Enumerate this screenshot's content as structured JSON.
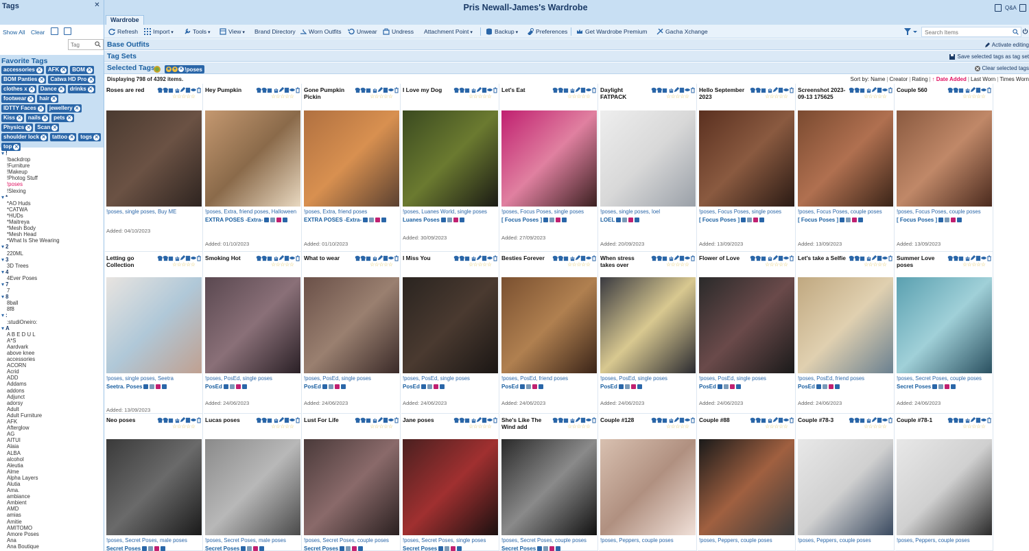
{
  "app": {
    "title": "Pris Newall-James's Wardrobe",
    "qa": "Q&A"
  },
  "tabs": [
    {
      "label": "Wardrobe"
    }
  ],
  "toolbar": {
    "refresh": "Refresh",
    "import": "Import",
    "tools": "Tools",
    "view": "View",
    "brand_directory": "Brand Directory",
    "worn_outfits": "Worn Outfits",
    "unwear": "Unwear",
    "undress": "Undress",
    "attachment_point": "Attachment Point",
    "backup": "Backup",
    "preferences": "Preferences",
    "premium": "Get Wardrobe Premium",
    "gacha": "Gacha Xchange",
    "search_placeholder": "Search Items"
  },
  "sidebar": {
    "title": "Tags",
    "show_all": "Show All",
    "clear": "Clear",
    "tag_placeholder": "Tag",
    "favorite_title": "Favorite Tags",
    "favorites": [
      "accessories",
      "AFK",
      "BOM",
      "BOM Panties",
      "Catwa HD Pro",
      "clothes x",
      "Dance",
      "drinks",
      "footwear",
      "hair",
      "IDTTY Faces",
      "jewellery",
      "Kiss",
      "nails",
      "pets",
      "Physics",
      "Scan",
      "shoulder lock",
      "tattoo",
      "togs",
      "top"
    ],
    "tree": [
      {
        "t": "g",
        "v": "!"
      },
      {
        "t": "i",
        "v": "!backdrop"
      },
      {
        "t": "i",
        "v": "!Furniture"
      },
      {
        "t": "i",
        "v": "!Makeup"
      },
      {
        "t": "i",
        "v": "!Photog Stuff"
      },
      {
        "t": "a",
        "v": "!poses"
      },
      {
        "t": "i",
        "v": "!Slexing"
      },
      {
        "t": "g",
        "v": "*"
      },
      {
        "t": "i",
        "v": "*AO Huds"
      },
      {
        "t": "i",
        "v": "*CATWA"
      },
      {
        "t": "i",
        "v": "*HUDs"
      },
      {
        "t": "i",
        "v": "*Maitreya"
      },
      {
        "t": "i",
        "v": "*Mesh Body"
      },
      {
        "t": "i",
        "v": "*Mesh Head"
      },
      {
        "t": "i",
        "v": "*What Is She Wearing"
      },
      {
        "t": "g",
        "v": "2"
      },
      {
        "t": "i",
        "v": "220ML"
      },
      {
        "t": "g",
        "v": "3"
      },
      {
        "t": "i",
        "v": "3D Trees"
      },
      {
        "t": "g",
        "v": "4"
      },
      {
        "t": "i",
        "v": "4Ever Poses"
      },
      {
        "t": "g",
        "v": "7"
      },
      {
        "t": "i",
        "v": "7"
      },
      {
        "t": "g",
        "v": "8"
      },
      {
        "t": "i",
        "v": "8ball"
      },
      {
        "t": "i",
        "v": "8f8"
      },
      {
        "t": "g",
        "v": ":"
      },
      {
        "t": "i",
        "v": ":studiOneiro:"
      },
      {
        "t": "g",
        "v": "A"
      },
      {
        "t": "i",
        "v": "A B E D U L"
      },
      {
        "t": "i",
        "v": "A*S"
      },
      {
        "t": "i",
        "v": "Aardvark"
      },
      {
        "t": "i",
        "v": "above knee"
      },
      {
        "t": "i",
        "v": "accessories"
      },
      {
        "t": "i",
        "v": "ACORN"
      },
      {
        "t": "i",
        "v": "Acrid"
      },
      {
        "t": "i",
        "v": "ADD"
      },
      {
        "t": "i",
        "v": "Addams"
      },
      {
        "t": "i",
        "v": "addons"
      },
      {
        "t": "i",
        "v": "Adjunct"
      },
      {
        "t": "i",
        "v": "adorsy"
      },
      {
        "t": "i",
        "v": "Adult"
      },
      {
        "t": "i",
        "v": "Adult Furniture"
      },
      {
        "t": "i",
        "v": "AFK"
      },
      {
        "t": "i",
        "v": "Afterglow"
      },
      {
        "t": "i",
        "v": "AG"
      },
      {
        "t": "i",
        "v": "AITUI"
      },
      {
        "t": "i",
        "v": "Alaia"
      },
      {
        "t": "i",
        "v": "ALBA"
      },
      {
        "t": "i",
        "v": "alcohol"
      },
      {
        "t": "i",
        "v": "Aleutia"
      },
      {
        "t": "i",
        "v": "Alme"
      },
      {
        "t": "i",
        "v": "Alpha Layers"
      },
      {
        "t": "i",
        "v": "Alutia"
      },
      {
        "t": "i",
        "v": "Ama."
      },
      {
        "t": "i",
        "v": "ambiance"
      },
      {
        "t": "i",
        "v": "Ambient"
      },
      {
        "t": "i",
        "v": "AMD"
      },
      {
        "t": "i",
        "v": "amias"
      },
      {
        "t": "i",
        "v": "Amitie"
      },
      {
        "t": "i",
        "v": "AMITOMO"
      },
      {
        "t": "i",
        "v": "Amore Poses"
      },
      {
        "t": "i",
        "v": "Ana"
      },
      {
        "t": "i",
        "v": "Ana Boutique"
      }
    ]
  },
  "sections": {
    "base_outfits": "Base Outfits",
    "activate_editing": "Activate editing",
    "tag_sets": "Tag Sets",
    "save_tags": "Save selected tags as tag set",
    "selected_tags": "Selected Tags",
    "selected_chip": "!poses",
    "clear_selected": "Clear selected tags"
  },
  "listing": {
    "display_count": "Displaying 798 of 4392 items.",
    "sort_label": "Sort by:",
    "sort_options": [
      "Name",
      "Creator",
      "Rating",
      "Date Added",
      "Last Worn",
      "Times Worn"
    ],
    "sort_active": "Date Added"
  },
  "items": [
    {
      "title": "Roses are red",
      "tags": "!poses, single poses, Buy ME",
      "creator": "",
      "added": "Added: 04/10/2023",
      "img": [
        "#4a3a30",
        "#6b5244",
        "#2e2420"
      ]
    },
    {
      "title": "Hey Pumpkin",
      "tags": "!poses, Extra, friend poses, Halloween",
      "creator": "EXTRA POSES -Extra-",
      "added": "Added: 01/10/2023",
      "img": [
        "#c49870",
        "#8a6a4a",
        "#e8d8c0"
      ]
    },
    {
      "title": "Gone Pumpkin Pickin",
      "tags": "!poses, Extra, friend poses",
      "creator": "EXTRA POSES -Extra-",
      "added": "Added: 01/10/2023",
      "img": [
        "#b07040",
        "#d89050",
        "#5a4030"
      ]
    },
    {
      "title": "I Love my Dog",
      "tags": "!poses, Luanes World, single poses",
      "creator": "Luanes Poses",
      "added": "Added: 30/09/2023",
      "img": [
        "#3a4a20",
        "#6b7a30",
        "#1a1a14"
      ]
    },
    {
      "title": "Let's Eat",
      "tags": "!poses, Focus Poses, single poses",
      "creator": "[ Focus Poses ]",
      "added": "Added: 27/09/2023",
      "img": [
        "#c02070",
        "#e080a0",
        "#3a2020"
      ]
    },
    {
      "title": "Daylight FATPACK",
      "tags": "!poses, single poses, loel",
      "creator": "LOEL",
      "added": "Added: 20/09/2023",
      "img": [
        "#eeeeee",
        "#d8d8d8",
        "#9aa0a8"
      ]
    },
    {
      "title": "Hello September 2023",
      "tags": "!poses, Focus Poses, single poses",
      "creator": "[ Focus Poses ]",
      "added": "Added: 13/09/2023",
      "img": [
        "#5a3020",
        "#8a5a40",
        "#2a1a14"
      ]
    },
    {
      "title": "Screenshot 2023-09-13 175625",
      "tags": "!poses, Focus Poses, couple poses",
      "creator": "[ Focus Poses ]",
      "added": "Added: 13/09/2023",
      "img": [
        "#7a4a30",
        "#b07050",
        "#3a2418"
      ]
    },
    {
      "title": "Couple 560",
      "tags": "!poses, Focus Poses, couple poses",
      "creator": "[ Focus Poses ]",
      "added": "Added: 13/09/2023",
      "img": [
        "#8a5a40",
        "#c08868",
        "#4a2a1e"
      ]
    },
    {
      "title": "Letting go Collection",
      "tags": "!poses, single poses, Seetra",
      "creator": "Seetra. Poses",
      "added": "Added: 13/09/2023",
      "img": [
        "#e8e4e0",
        "#b0c8d8",
        "#c0a090"
      ]
    },
    {
      "title": "Smoking Hot",
      "tags": "!poses, PosEd, single poses",
      "creator": "PosEd",
      "added": "Added: 24/06/2023",
      "img": [
        "#5a4850",
        "#8a7078",
        "#2a2026"
      ]
    },
    {
      "title": "What to wear",
      "tags": "!poses, PosEd, single poses",
      "creator": "PosEd",
      "added": "Added: 24/06/2023",
      "img": [
        "#6a5048",
        "#9a8070",
        "#3a2a28"
      ]
    },
    {
      "title": "I Miss You",
      "tags": "!poses, PosEd, single poses",
      "creator": "PosEd",
      "added": "Added: 24/06/2023",
      "img": [
        "#2a2420",
        "#4a3a30",
        "#1a1614"
      ]
    },
    {
      "title": "Besties Forever",
      "tags": "!poses, PosEd, friend poses",
      "creator": "PosEd",
      "added": "Added: 24/06/2023",
      "img": [
        "#7a5030",
        "#b08050",
        "#3a2418"
      ]
    },
    {
      "title": "When stress takes over",
      "tags": "!poses, PosEd, single poses",
      "creator": "PosEd",
      "added": "Added: 24/06/2023",
      "img": [
        "#3a3a40",
        "#d8c890",
        "#2a2a30"
      ]
    },
    {
      "title": "Flower of Love",
      "tags": "!poses, PosEd, single poses",
      "creator": "PosEd",
      "added": "Added: 24/06/2023",
      "img": [
        "#2a2a2a",
        "#6a4a4a",
        "#1a1a1a"
      ]
    },
    {
      "title": "Let's take a Selfie",
      "tags": "!poses, PosEd, friend poses",
      "creator": "PosEd",
      "added": "Added: 24/06/2023",
      "img": [
        "#c0a880",
        "#e0d0b0",
        "#6a8090"
      ]
    },
    {
      "title": "Summer Love poses",
      "tags": "!poses, Secret Poses, couple poses",
      "creator": "Secret Poses",
      "added": "Added: 24/06/2023",
      "img": [
        "#5aa0b0",
        "#a0d0d8",
        "#2a5060"
      ]
    },
    {
      "title": "Neo poses",
      "tags": "!poses, Secret Poses, male poses",
      "creator": "Secret Poses",
      "added": "",
      "img": [
        "#3a3a3a",
        "#6a6a6a",
        "#1a1a1a"
      ]
    },
    {
      "title": "Lucas poses",
      "tags": "!poses, Secret Poses, male poses",
      "creator": "Secret Poses",
      "added": "",
      "img": [
        "#8a8a8a",
        "#b8b8b8",
        "#4a4a4a"
      ]
    },
    {
      "title": "Lust For Life",
      "tags": "!poses, Secret Poses, couple poses",
      "creator": "Secret Poses",
      "added": "",
      "img": [
        "#4a3a3a",
        "#8a6a6a",
        "#2a2020"
      ]
    },
    {
      "title": "Jane poses",
      "tags": "!poses, Secret Poses, single poses",
      "creator": "Secret Poses",
      "added": "",
      "img": [
        "#4a2020",
        "#a03030",
        "#1a1010"
      ]
    },
    {
      "title": "She's Like The Wind add",
      "tags": "!poses, Secret Poses, couple poses",
      "creator": "Secret Poses",
      "added": "",
      "img": [
        "#2a2a2a",
        "#8a8a8a",
        "#111111"
      ]
    },
    {
      "title": "Couple #128",
      "tags": "!poses, Peppers, couple poses",
      "creator": "",
      "added": "",
      "img": [
        "#d8c0b0",
        "#b09080",
        "#f0e0d8"
      ]
    },
    {
      "title": "Couple #88",
      "tags": "!poses, Peppers, couple poses",
      "creator": "",
      "added": "",
      "img": [
        "#1a1a1a",
        "#a06040",
        "#3a3a3a"
      ]
    },
    {
      "title": "Couple #78-3",
      "tags": "!poses, Peppers, couple poses",
      "creator": "",
      "added": "",
      "img": [
        "#e8e8e8",
        "#d0d0d0",
        "#3a4a60"
      ]
    },
    {
      "title": "Couple #78-1",
      "tags": "!poses, Peppers, couple poses",
      "creator": "",
      "added": "",
      "img": [
        "#e8e8e8",
        "#d0d0d0",
        "#2a2a2a"
      ]
    }
  ],
  "colors": {
    "accent": "#2a66a8",
    "header": "#c8dff3",
    "active": "#e01060",
    "star": "#d9b94a"
  }
}
